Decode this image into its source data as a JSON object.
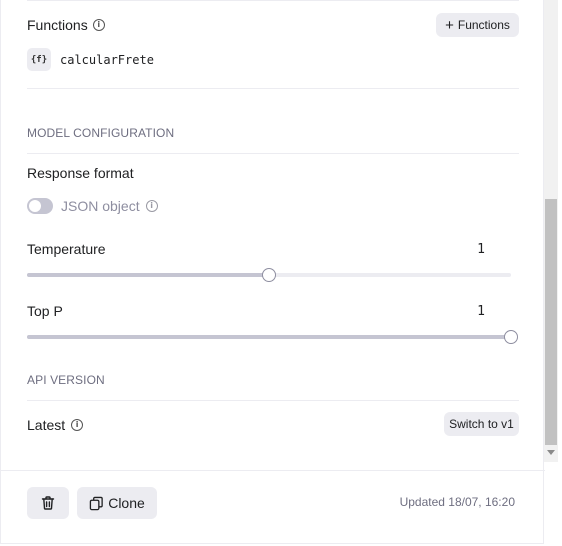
{
  "functions": {
    "title": "Functions",
    "add_button": "Functions",
    "items": [
      {
        "badge": "{f}",
        "name": "calcularFrete"
      }
    ]
  },
  "model_config": {
    "section_title": "MODEL CONFIGURATION",
    "response_format": {
      "title": "Response format",
      "toggle_label": "JSON object",
      "enabled": false
    },
    "temperature": {
      "label": "Temperature",
      "value": "1",
      "fraction": 0.5
    },
    "top_p": {
      "label": "Top P",
      "value": "1",
      "fraction": 1.0
    }
  },
  "api_version": {
    "section_title": "API VERSION",
    "current": "Latest",
    "switch_button": "Switch to v1"
  },
  "footer": {
    "clone_label": "Clone",
    "updated_text": "Updated 18/07, 16:20"
  },
  "icons": {
    "info": "info-icon",
    "plus": "plus-icon",
    "trash": "trash-icon",
    "clone": "copy-icon"
  },
  "colors": {
    "button_bg": "#ececf1",
    "slider_fill": "#c5c5d2",
    "muted_text": "#6e6e80"
  }
}
